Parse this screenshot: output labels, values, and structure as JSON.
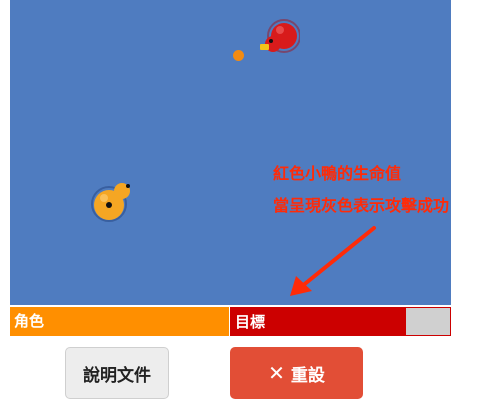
{
  "annotation": {
    "line1": "紅色小鴨的生命值",
    "line2": "當呈現灰色表示攻擊成功"
  },
  "status": {
    "player_label": "角色",
    "target_label": "目標",
    "target_health": 0.8
  },
  "buttons": {
    "manual_label": "說明文件",
    "reset_icon": "✕",
    "reset_label": "重設"
  },
  "colors": {
    "field": "#4f7cc0",
    "player_duck": "#f5a623",
    "target_duck": "#d81b1b",
    "player_bar": "#ff8f00",
    "target_bar": "#cc0000",
    "reset_button": "#e24e36",
    "annotation": "#ff2b08"
  },
  "icons": [
    "player-duck-icon",
    "target-duck-icon",
    "close-icon"
  ]
}
